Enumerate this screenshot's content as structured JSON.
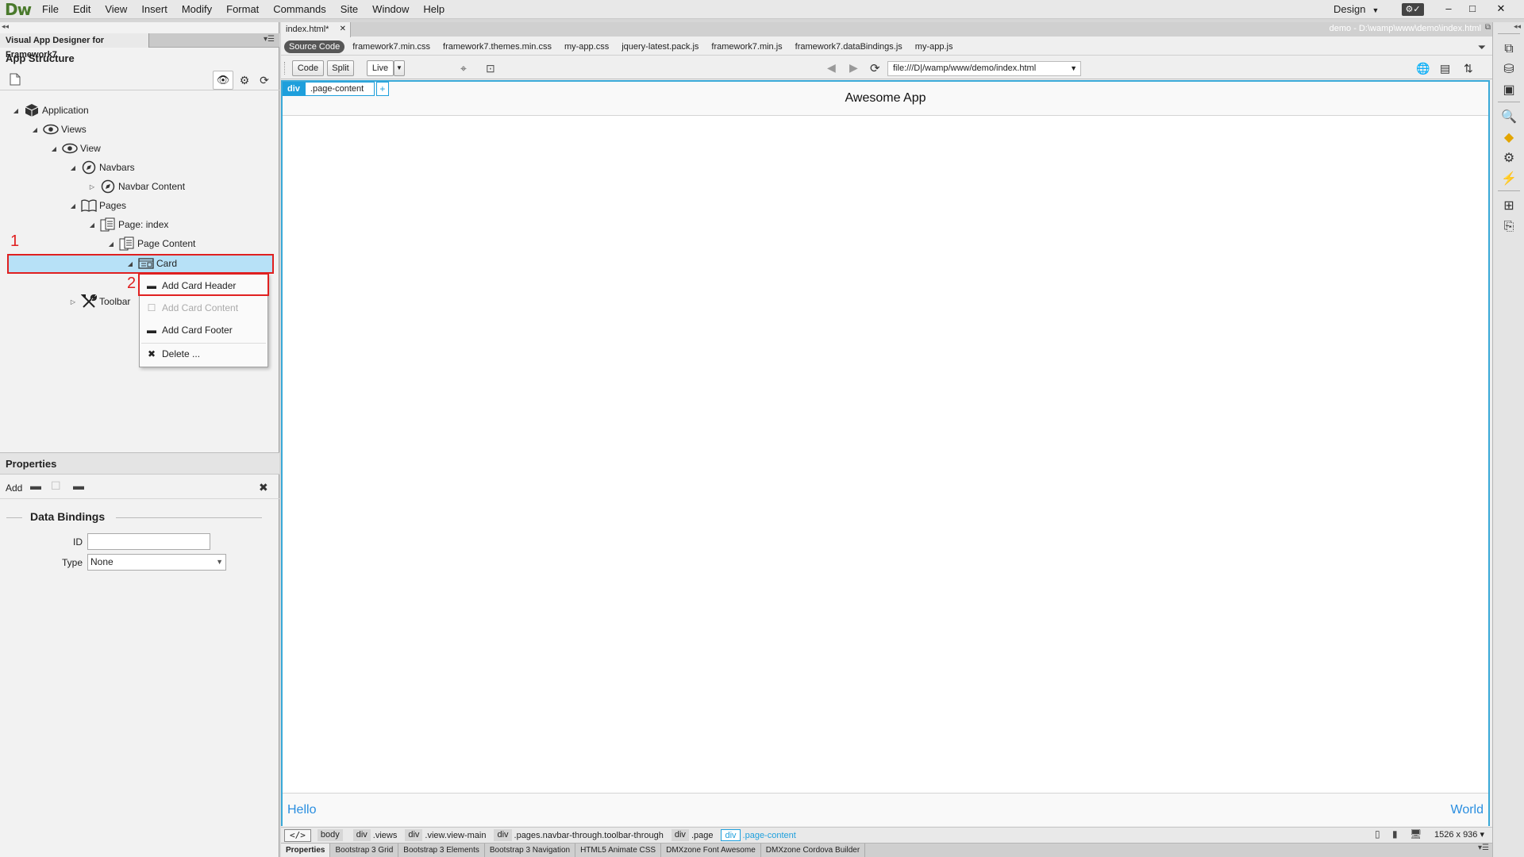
{
  "app": {
    "logo": "Dw"
  },
  "menu": [
    "File",
    "Edit",
    "View",
    "Insert",
    "Modify",
    "Format",
    "Commands",
    "Site",
    "Window",
    "Help"
  ],
  "workspace": {
    "label": "Design"
  },
  "window_controls": {
    "minimize": "–",
    "maximize": "□",
    "close": "✕"
  },
  "left_panel": {
    "tab_label": "Visual App Designer for Framework7",
    "section_title": "App Structure",
    "tree": [
      {
        "label": "Application",
        "icon": "cube-icon"
      },
      {
        "label": "Views",
        "icon": "eye-icon"
      },
      {
        "label": "View",
        "icon": "eye-icon"
      },
      {
        "label": "Navbars",
        "icon": "compass-icon"
      },
      {
        "label": "Navbar Content",
        "icon": "compass-icon"
      },
      {
        "label": "Pages",
        "icon": "book-icon"
      },
      {
        "label": "Page: index",
        "icon": "pages-icon"
      },
      {
        "label": "Page Content",
        "icon": "pages-icon"
      },
      {
        "label": "Card",
        "icon": "card-icon"
      },
      {
        "label": "Toolbar",
        "icon": "tools-icon"
      }
    ],
    "annotations": {
      "first": "1",
      "second": "2"
    }
  },
  "context_menu": {
    "items": [
      {
        "label": "Add Card Header",
        "icon": "minus-icon",
        "enabled": true
      },
      {
        "label": "Add Card Content",
        "icon": "square-icon",
        "enabled": false
      },
      {
        "label": "Add Card Footer",
        "icon": "minus-icon",
        "enabled": true
      },
      {
        "label": "Delete ...",
        "icon": "close-icon",
        "enabled": true
      }
    ]
  },
  "properties": {
    "title": "Properties",
    "add_label": "Add",
    "section_title": "Data Bindings",
    "id_label": "ID",
    "id_value": "",
    "type_label": "Type",
    "type_value": "None"
  },
  "document": {
    "tab_label": "index.html*",
    "path": "demo - D:\\wamp\\www\\demo\\index.html",
    "source_code_label": "Source Code",
    "related_files": [
      "framework7.min.css",
      "framework7.themes.min.css",
      "my-app.css",
      "jquery-latest.pack.js",
      "framework7.min.js",
      "framework7.dataBindings.js",
      "my-app.js"
    ],
    "view_buttons": {
      "code": "Code",
      "split": "Split",
      "live": "Live"
    },
    "address": "file:///D|/wamp/www/demo/index.html"
  },
  "live_view": {
    "hud_tag": "div",
    "hud_class": ".page-content",
    "hud_add": "+",
    "app_title": "Awesome App",
    "toolbar_left": "Hello",
    "toolbar_right": "World"
  },
  "tag_selector": {
    "code_toggle": "</>",
    "crumbs": [
      {
        "tag": "body",
        "cls": ""
      },
      {
        "tag": "div",
        "cls": ".views"
      },
      {
        "tag": "div",
        "cls": ".view.view-main"
      },
      {
        "tag": "div",
        "cls": ".pages.navbar-through.toolbar-through"
      },
      {
        "tag": "div",
        "cls": ".page"
      },
      {
        "tag": "div",
        "cls": ".page-content"
      }
    ],
    "viewport": "1526 x 936"
  },
  "bottom_tabs": [
    "Properties",
    "Bootstrap 3 Grid",
    "Bootstrap 3 Elements",
    "Bootstrap 3 Navigation",
    "HTML5 Animate CSS",
    "DMXzone Font Awesome",
    "DMXzone Cordova Builder"
  ]
}
